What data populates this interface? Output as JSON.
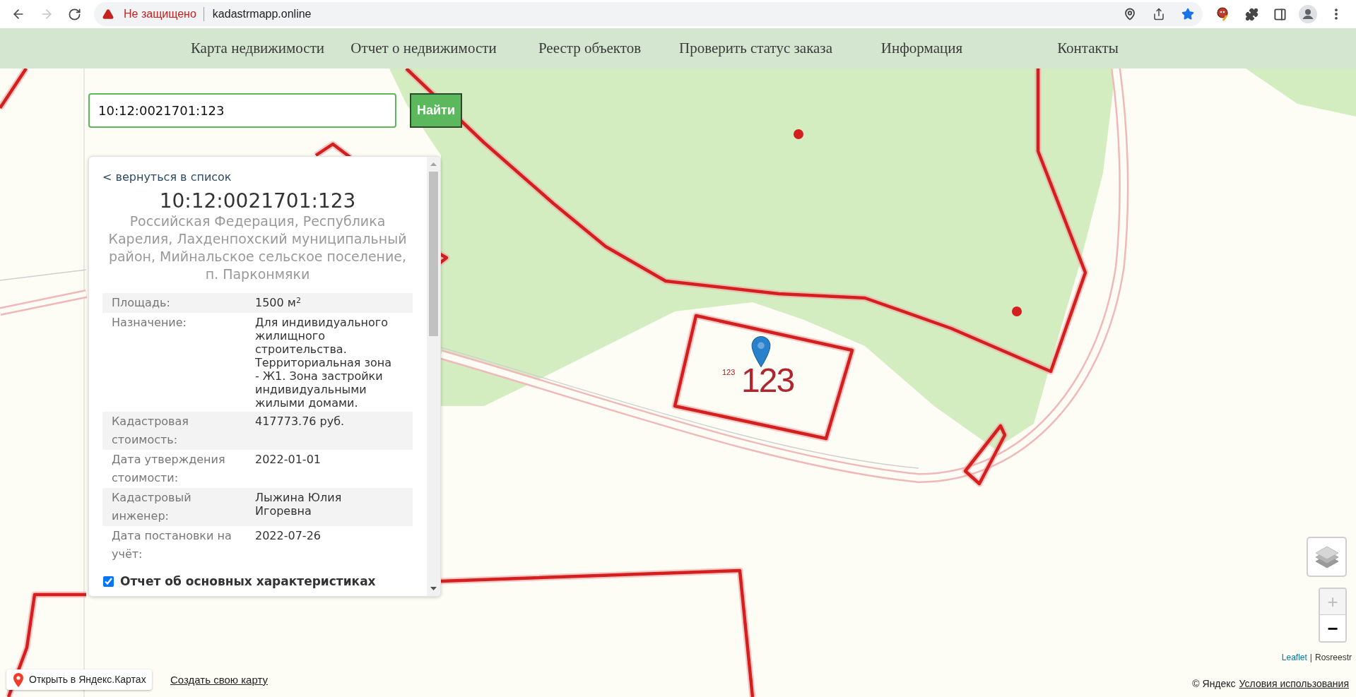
{
  "browser": {
    "nav_buttons": [
      {
        "kind": "back",
        "disabled": false
      },
      {
        "kind": "forward",
        "disabled": true
      },
      {
        "kind": "reload",
        "disabled": false
      }
    ],
    "address_bar": {
      "security_label": "Не защищено",
      "url": "kadastrmapp.online",
      "bookmarked": true
    }
  },
  "site_nav": {
    "items": [
      "Карта недвижимости",
      "Отчет о недвижимости",
      "Реестр объектов",
      "Проверить статус заказа",
      "Информация",
      "Контакты"
    ]
  },
  "search": {
    "value": "10:12:0021701:123",
    "button": "Найти"
  },
  "info_panel": {
    "back_link": "< вернуться в список",
    "title": "10:12:0021701:123",
    "address": "Российская Федерация, Республика Карелия, Лахденпохский муниципальный район, Мийнальское сельское поселение, п. Парконмяки",
    "properties": [
      {
        "label": "Площадь:",
        "value": "1500 м$^{2}$"
      },
      {
        "label": "Назначение:",
        "value": "Для индивидуального жилищного строительства. Территориальная зона - Ж1. Зона застройки индивидуальными жилыми домами."
      },
      {
        "label": "Кадастровая стоимость:",
        "value": "417773.76 руб."
      },
      {
        "label": "Дата утверждения стоимости:",
        "value": "2022-01-01"
      },
      {
        "label": "Кадастровый инженер:",
        "value": "Лыжина Юлия Игоревна"
      },
      {
        "label": "Дата постановки на учёт:",
        "value": "2022-07-26"
      }
    ],
    "report_option": {
      "label": "Отчет об основных характеристиках",
      "checked": true
    }
  },
  "map": {
    "parcel_labels": [
      {
        "kind": "small",
        "text": "123"
      },
      {
        "kind": "large",
        "text": "123"
      }
    ],
    "zoom_controls": [
      {
        "label": "+",
        "disabled": true
      },
      {
        "label": "−",
        "disabled": false
      }
    ],
    "attribution": {
      "link": "Leaflet",
      "separator": "|",
      "text": "Rosreestr"
    }
  },
  "yandex_footer": {
    "open_button": "Открыть в Яндекс.Картах",
    "create_link": "Создать свою карту",
    "copyright": "© Яндекс",
    "terms_link": "Условия использования"
  }
}
